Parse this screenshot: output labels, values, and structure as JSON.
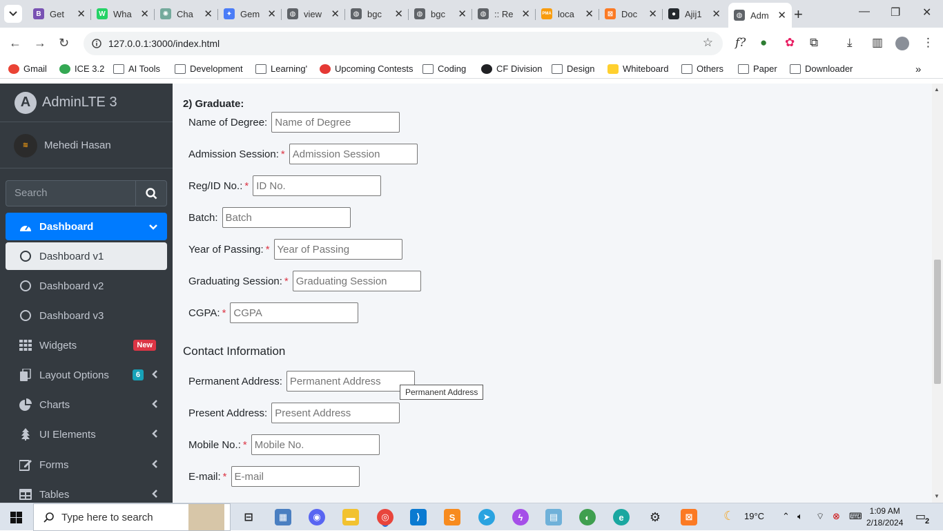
{
  "browser": {
    "tabs": [
      {
        "title": "Get",
        "icon": "bootstrap-icon",
        "color": "#7952b3",
        "glyph": "B"
      },
      {
        "title": "Wha",
        "icon": "whatsapp-icon",
        "color": "#25d366",
        "glyph": "W"
      },
      {
        "title": "Cha",
        "icon": "chatgpt-icon",
        "color": "#74aa9c",
        "glyph": "✺"
      },
      {
        "title": "Gem",
        "icon": "gemini-icon",
        "color": "#4a7cf7",
        "glyph": "✦"
      },
      {
        "title": "view",
        "icon": "globe-icon",
        "color": "#5f6368",
        "glyph": "◍"
      },
      {
        "title": "bgc",
        "icon": "globe-icon",
        "color": "#5f6368",
        "glyph": "◍"
      },
      {
        "title": "bgc",
        "icon": "globe-icon",
        "color": "#5f6368",
        "glyph": "◍"
      },
      {
        "title": ":: Re",
        "icon": "globe-icon",
        "color": "#5f6368",
        "glyph": "◍"
      },
      {
        "title": "loca",
        "icon": "phpmyadmin-icon",
        "color": "#f89c0e",
        "glyph": "PMA"
      },
      {
        "title": "Doc",
        "icon": "xampp-icon",
        "color": "#fb7a24",
        "glyph": "⊠"
      },
      {
        "title": "Ajij1",
        "icon": "github-icon",
        "color": "#24292e",
        "glyph": "●"
      },
      {
        "title": "Adm",
        "icon": "globe-icon",
        "color": "#5f6368",
        "glyph": "◍"
      }
    ],
    "url": "127.0.0.1:3000/index.html",
    "bookmarks": [
      {
        "label": "Gmail",
        "icon": "gmail-icon"
      },
      {
        "label": "ICE 3.2",
        "icon": "drive-icon"
      },
      {
        "label": "AI Tools",
        "icon": "folder-icon"
      },
      {
        "label": "Development",
        "icon": "folder-icon"
      },
      {
        "label": "Learning'",
        "icon": "folder-icon"
      },
      {
        "label": "Upcoming Contests",
        "icon": "clist-icon"
      },
      {
        "label": "Coding",
        "icon": "folder-icon"
      },
      {
        "label": "CF Division",
        "icon": "globe-icon"
      },
      {
        "label": "Design",
        "icon": "folder-icon"
      },
      {
        "label": "Whiteboard",
        "icon": "miro-icon"
      },
      {
        "label": "Others",
        "icon": "folder-icon"
      },
      {
        "label": "Paper",
        "icon": "folder-icon"
      },
      {
        "label": "Downloader",
        "icon": "folder-icon"
      }
    ]
  },
  "sidebar": {
    "brand": "AdminLTE 3",
    "user": "Mehedi Hasan",
    "search_placeholder": "Search",
    "items": [
      {
        "label": "Dashboard",
        "icon": "tachometer-icon"
      },
      {
        "label": "Dashboard v1",
        "icon": "circle-icon"
      },
      {
        "label": "Dashboard v2",
        "icon": "circle-icon"
      },
      {
        "label": "Dashboard v3",
        "icon": "circle-icon"
      },
      {
        "label": "Widgets",
        "icon": "th-icon",
        "badge": "New",
        "badge_color": "#dc3545"
      },
      {
        "label": "Layout Options",
        "icon": "copy-icon",
        "badge": "6",
        "badge_color": "#17a2b8"
      },
      {
        "label": "Charts",
        "icon": "pie-chart-icon"
      },
      {
        "label": "UI Elements",
        "icon": "tree-icon"
      },
      {
        "label": "Forms",
        "icon": "edit-icon"
      },
      {
        "label": "Tables",
        "icon": "table-icon"
      }
    ]
  },
  "form": {
    "section_title": "2) Graduate:",
    "fields": [
      {
        "label": "Name of Degree:",
        "required": false,
        "placeholder": "Name of Degree"
      },
      {
        "label": "Admission Session:",
        "required": true,
        "placeholder": "Admission Session"
      },
      {
        "label": "Reg/ID No.:",
        "required": true,
        "placeholder": "ID No."
      },
      {
        "label": "Batch:",
        "required": false,
        "placeholder": "Batch"
      },
      {
        "label": "Year of Passing:",
        "required": true,
        "placeholder": "Year of Passing"
      },
      {
        "label": "Graduating Session:",
        "required": true,
        "placeholder": "Graduating Session"
      },
      {
        "label": "CGPA:",
        "required": true,
        "placeholder": "CGPA"
      }
    ],
    "contact_title": "Contact Information",
    "contact_fields": [
      {
        "label": "Permanent Address:",
        "required": false,
        "placeholder": "Permanent Address"
      },
      {
        "label": "Present Address:",
        "required": false,
        "placeholder": "Present Address"
      },
      {
        "label": "Mobile No.:",
        "required": true,
        "placeholder": "Mobile No."
      },
      {
        "label": "E-mail:",
        "required": true,
        "placeholder": "E-mail"
      }
    ],
    "required_mark": "*",
    "tooltip": "Permanent Address"
  },
  "taskbar": {
    "search_placeholder": "Type here to search",
    "weather": "19°C",
    "time": "1:09 AM",
    "date": "2/18/2024",
    "notifications": "2"
  }
}
